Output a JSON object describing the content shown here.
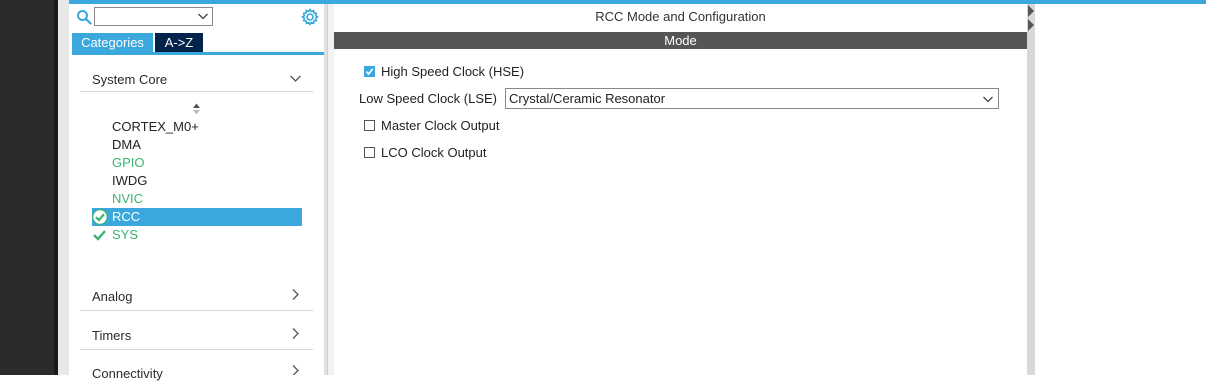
{
  "left_panel": {
    "search": {
      "value": "",
      "placeholder": ""
    },
    "tabs": [
      {
        "label": "Categories",
        "active": true
      },
      {
        "label": "A->Z",
        "active": false
      }
    ],
    "categories": [
      {
        "label": "System Core",
        "expanded": true
      },
      {
        "label": "Analog",
        "expanded": false
      },
      {
        "label": "Timers",
        "expanded": false
      },
      {
        "label": "Connectivity",
        "expanded": false
      }
    ],
    "system_core_items": [
      {
        "label": "CORTEX_M0+",
        "color": "#222222",
        "status": "none"
      },
      {
        "label": "DMA",
        "color": "#222222",
        "status": "none"
      },
      {
        "label": "GPIO",
        "color": "#3cb371",
        "status": "none"
      },
      {
        "label": "IWDG",
        "color": "#222222",
        "status": "none"
      },
      {
        "label": "NVIC",
        "color": "#3cb371",
        "status": "none"
      },
      {
        "label": "RCC",
        "color": "#ffffff",
        "status": "selected-check"
      },
      {
        "label": "SYS",
        "color": "#3cb371",
        "status": "check"
      }
    ]
  },
  "main": {
    "title": "RCC Mode and Configuration",
    "section": "Mode",
    "options": {
      "hse": {
        "label": "High Speed Clock (HSE)",
        "checked": true
      },
      "lse": {
        "label": "Low Speed Clock (LSE)",
        "value": "Crystal/Ceramic Resonator"
      },
      "mco": {
        "label": "Master Clock Output",
        "checked": false
      },
      "lco": {
        "label": "LCO Clock Output",
        "checked": false
      }
    }
  },
  "colors": {
    "accent": "#3aa7dd",
    "tab_dark": "#03234b",
    "mode_bar": "#555555",
    "ok_green": "#3cb371"
  },
  "icons": [
    "search-icon",
    "gear-icon",
    "chevron-down-icon",
    "chevron-right-icon",
    "sort-arrows-icon",
    "check-icon",
    "check-circle-icon"
  ]
}
